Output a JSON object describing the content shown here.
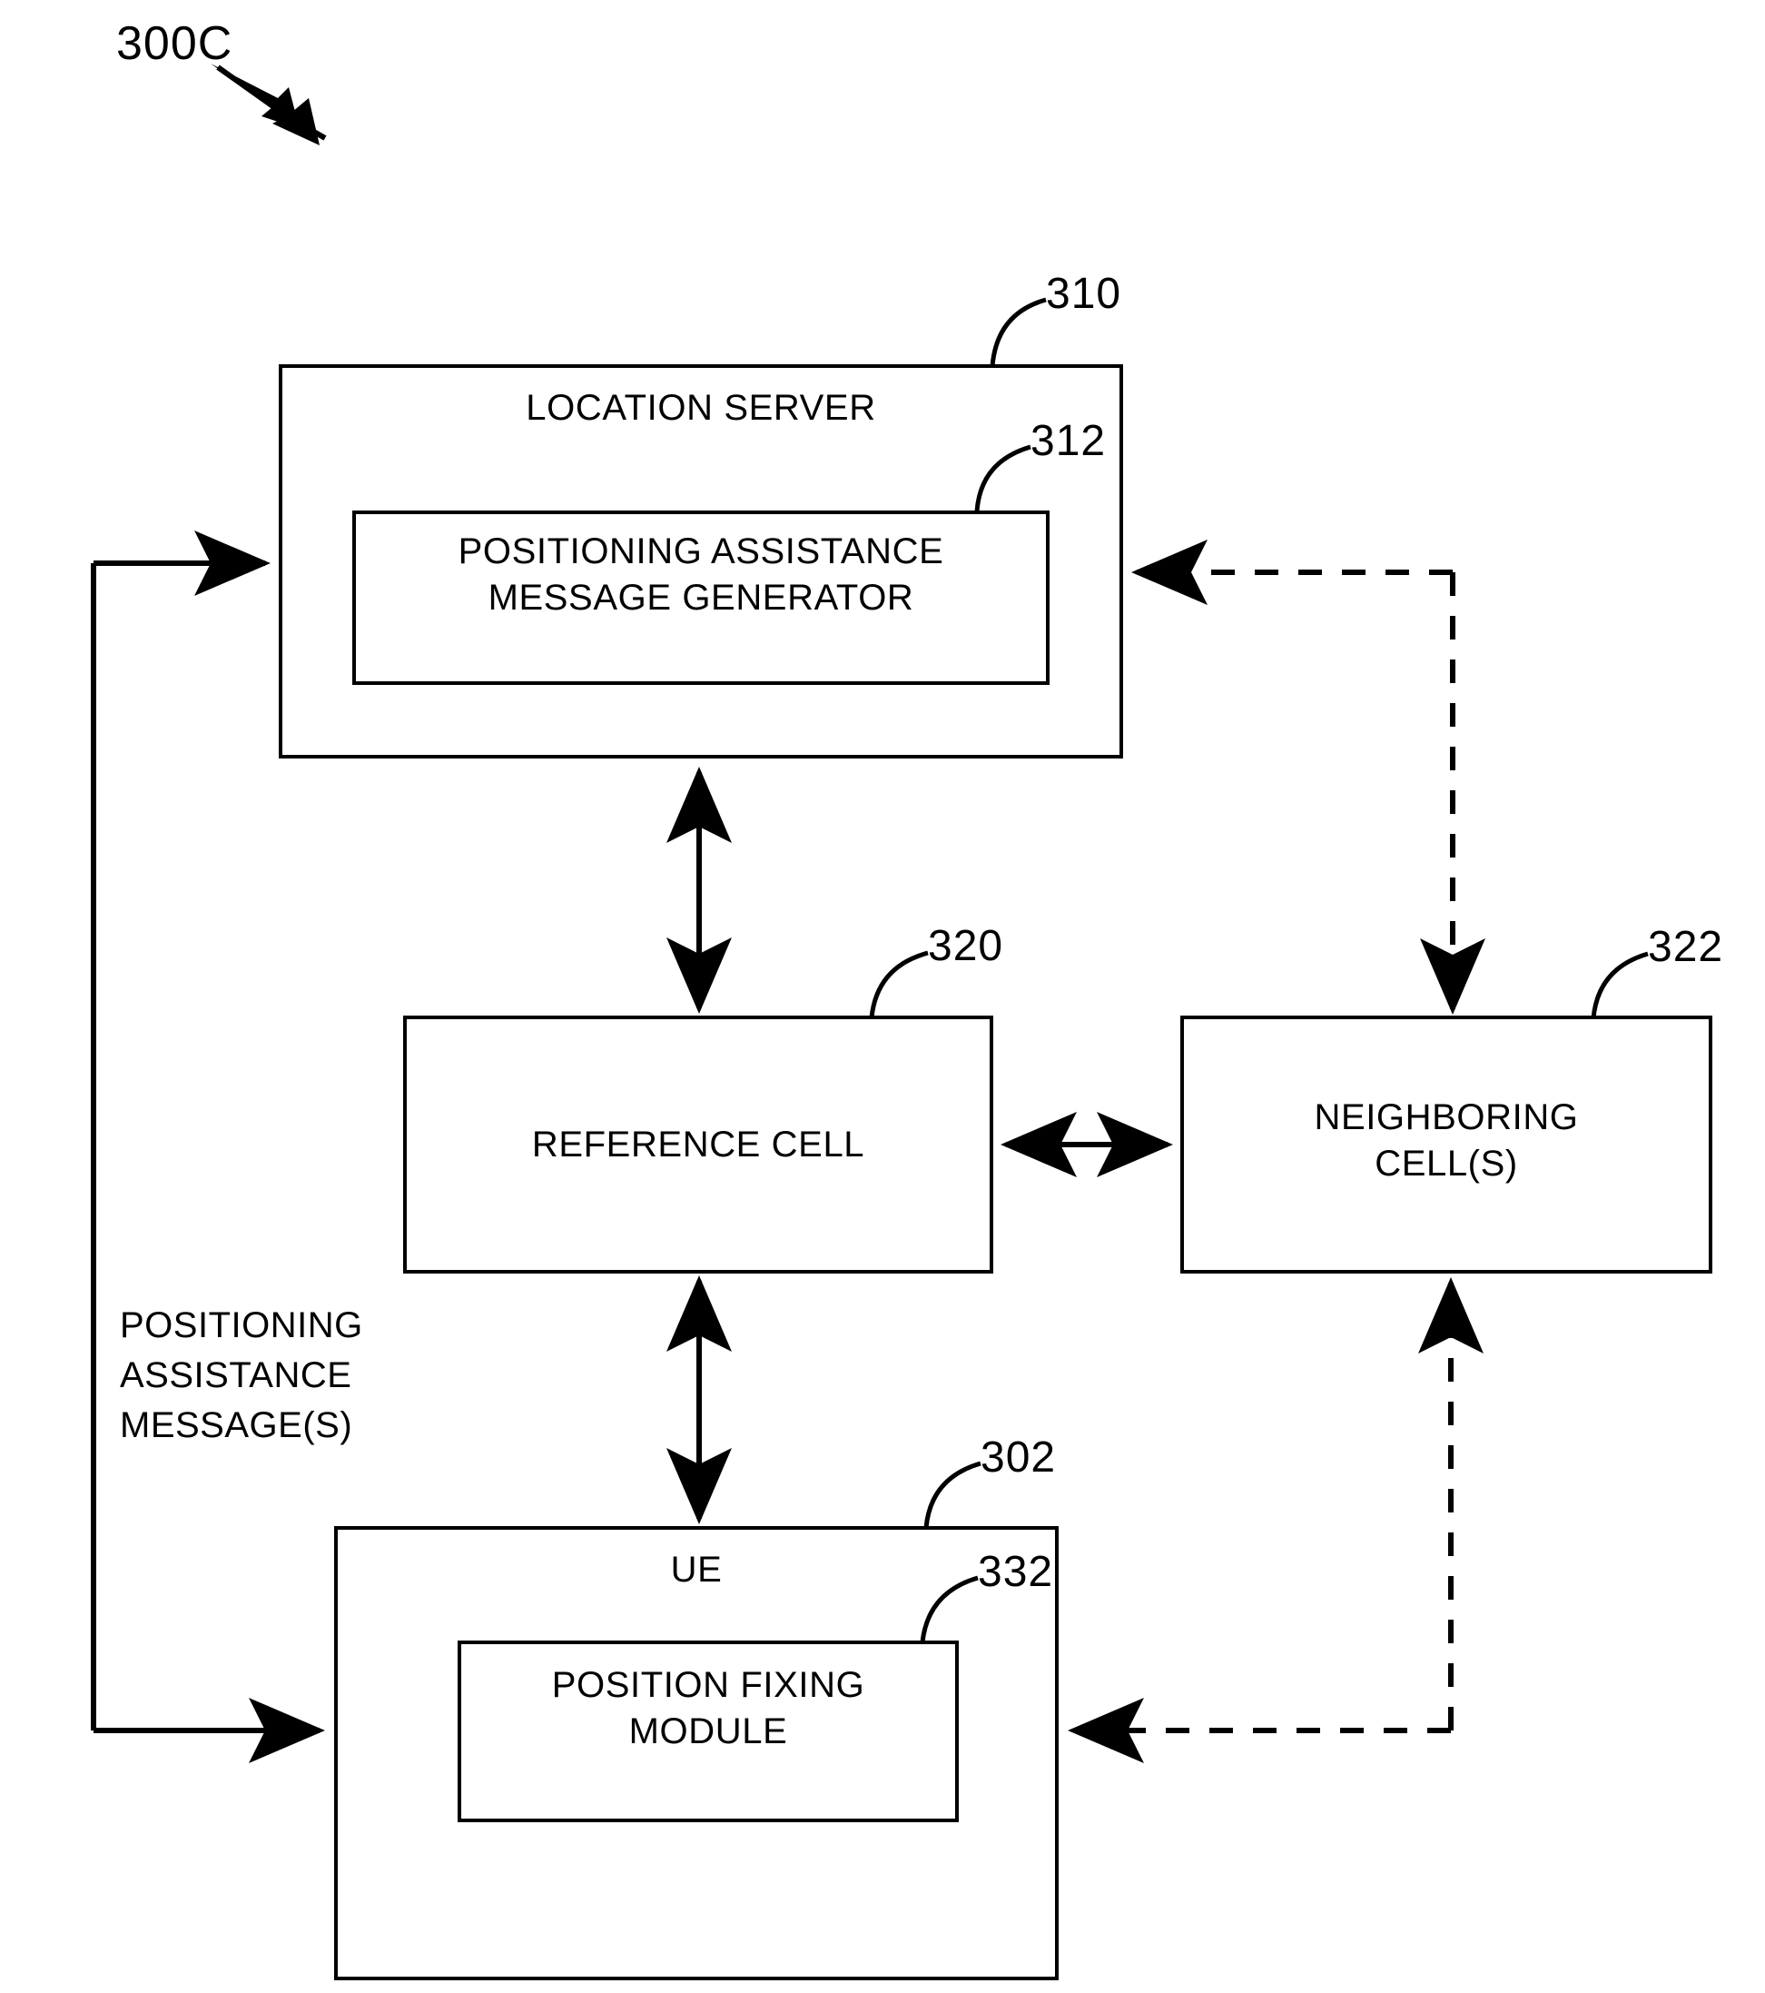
{
  "figure": {
    "id_label": "300C"
  },
  "nodes": {
    "location_server": {
      "title": "LOCATION SERVER",
      "ref": "310"
    },
    "pam_generator": {
      "title": "POSITIONING ASSISTANCE\nMESSAGE GENERATOR",
      "ref": "312"
    },
    "reference_cell": {
      "title": "REFERENCE CELL",
      "ref": "320"
    },
    "neighboring_cells": {
      "title": "NEIGHBORING\nCELL(S)",
      "ref": "322"
    },
    "ue": {
      "title": "UE",
      "ref": "302"
    },
    "position_fixing_module": {
      "title": "POSITION FIXING\nMODULE",
      "ref": "332"
    }
  },
  "annotations": {
    "positioning_assistance_messages": "POSITIONING\nASSISTANCE\nMESSAGE(S)"
  },
  "style": {
    "line_color": "#000000",
    "background": "#ffffff"
  }
}
